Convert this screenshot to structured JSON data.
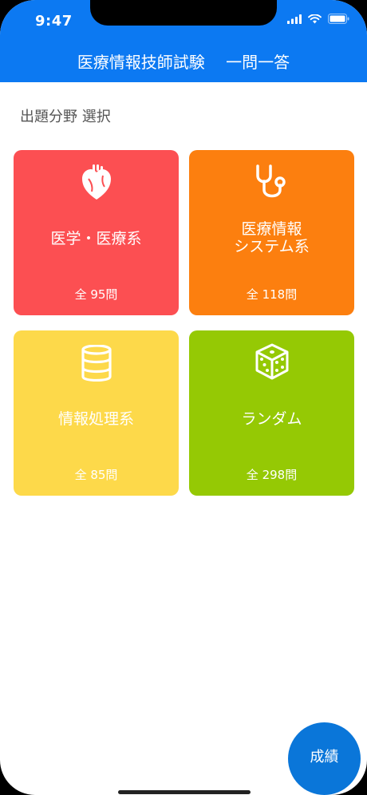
{
  "status_bar": {
    "time": "9:47"
  },
  "header": {
    "title": "医療情報技師試験　 一問一答"
  },
  "section_label": "出題分野 選択",
  "cards": [
    {
      "label": "医学・医療系",
      "count": "全 95問",
      "color": "#fc4f52",
      "icon": "heart-icon"
    },
    {
      "label": "医療情報\nシステム系",
      "count": "全 118問",
      "color": "#fc7f0f",
      "icon": "stethoscope-icon"
    },
    {
      "label": "情報処理系",
      "count": "全 85問",
      "color": "#fdd94a",
      "icon": "database-icon"
    },
    {
      "label": "ランダム",
      "count": "全 298問",
      "color": "#95c904",
      "icon": "dice-icon"
    }
  ],
  "fab": {
    "label": "成績"
  }
}
